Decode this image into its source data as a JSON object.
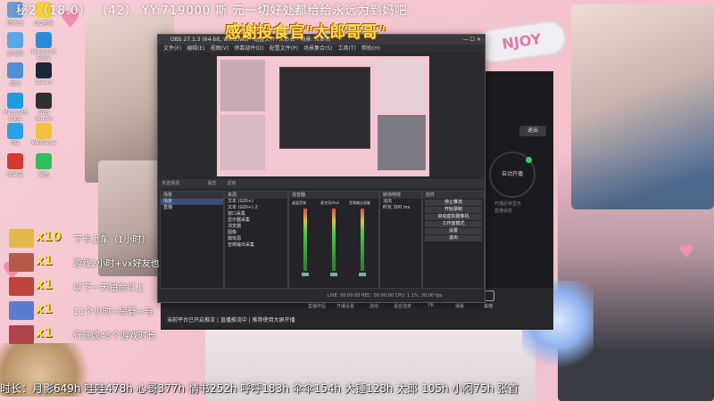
{
  "overlay": {
    "top_line": "秘2（18.0）  （42）  YY:719000 斯 元一切好处都给给永远为到妈吧",
    "banner": "感谢投食官\"太郎哥哥\"",
    "enjoy_badge": "NJOY",
    "gifts": [
      {
        "count": "x10",
        "text": "下卡上车（1小时）",
        "color": "#e0b94a"
      },
      {
        "count": "x1",
        "text": "游戏2小时+vx好友也",
        "color": "#b45a4a"
      },
      {
        "count": "x1",
        "text": "以下一天铂金以上",
        "color": "#c2423d"
      },
      {
        "count": "x1",
        "text": "11个小时+房管+与",
        "color": "#5a7bd0"
      },
      {
        "count": "x1",
        "text": "行证或45个游戏时长",
        "color": "#b0424a"
      }
    ],
    "bottom_stats": "时长：月影649h 哇哇478h 心哥377h 情书252h 呼呼183h 伞伞154h 大锤128h 太郎 105h 小闷75h 张首"
  },
  "desktop_icons": [
    {
      "label": "回收站",
      "color": "#6e9bd6"
    },
    {
      "label": "QQ音乐",
      "color": "#f3d13c"
    },
    {
      "label": "此电脑",
      "color": "#5aa6e8"
    },
    {
      "label": "Microsoft Edge",
      "color": "#2c8ad6"
    },
    {
      "label": "网络",
      "color": "#4f8fd4"
    },
    {
      "label": "Steam",
      "color": "#1b2838"
    },
    {
      "label": "Microsoft Edge",
      "color": "#1f9be0"
    },
    {
      "label": "OBS Studio",
      "color": "#303030"
    },
    {
      "label": "QQ",
      "color": "#2aa0e8"
    },
    {
      "label": "WeGame",
      "color": "#f3c13a"
    },
    {
      "label": "网易云",
      "color": "#d33a31"
    },
    {
      "label": "微信",
      "color": "#2fbf5c"
    }
  ],
  "obs": {
    "title": "OBS 27.1.3 (64-bit, windows) - 配置文件: 未命名 - 场景: 未命名",
    "menu": [
      "文件(F)",
      "编辑(E)",
      "视图(V)",
      "停靠部件(D)",
      "配置文件(P)",
      "场景集合(S)",
      "工具(T)",
      "帮助(H)"
    ],
    "scene_bar": "未选择源",
    "props_label": "属性",
    "filters_label": "滤镜",
    "docks": {
      "scenes": {
        "title": "场景",
        "items": [
          "场景",
          "直播"
        ]
      },
      "sources": {
        "title": "来源",
        "items": [
          "文本 (GDI+)",
          "文本 (GDI+) 2",
          "窗口采集",
          "显示器采集",
          "浏览器",
          "图像",
          "媒体源",
          "音频输出采集"
        ]
      },
      "mixer": {
        "title": "混音器",
        "channels": [
          "桌面音频",
          "麦克风/Aux",
          "音频输出采集"
        ]
      },
      "transitions": {
        "title": "转场特效",
        "type": "淡出",
        "duration_label": "时长",
        "duration": "300 ms"
      },
      "controls": {
        "title": "控件",
        "buttons": [
          "停止推流",
          "开始录制",
          "启动虚拟摄像机",
          "工作室模式",
          "设置",
          "退出"
        ]
      }
    },
    "status": "LIVE: 00:00:00   REC: 00:00:00   CPU: 1.1%, 30.00 fps"
  },
  "tool": {
    "toolbar": [
      "直播伴侣",
      "开播设置",
      "连线",
      "语音连麦",
      "PK",
      "弹幕",
      "其他"
    ],
    "notice": "当前平台已开启推流 | 直播推流中 | 推荐使用大屏开播",
    "exit_label": "退出",
    "go_live_label": "自动开播",
    "sub_text_1": "开播后将显示",
    "sub_text_2": "直播状态"
  },
  "colors": {
    "background": "#f5c6d0",
    "banner": "#f4e15a",
    "gift_count": "#f5e14a",
    "obs_bg": "#2b2b2f",
    "live_dot": "#2fd06a"
  }
}
